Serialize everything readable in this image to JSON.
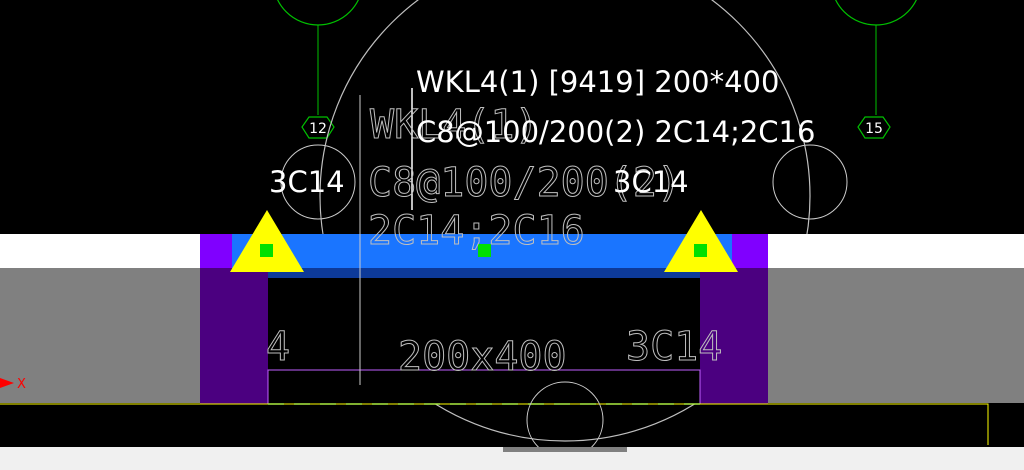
{
  "beam_annotation": {
    "line1": "WKL4(1) [9419] 200*400",
    "line2": "C8@100/200(2) 2C14;2C16"
  },
  "cad_text": {
    "beam_name": "WKL4(1)",
    "stirrups": "C8@100/200(2)",
    "top_bars": "2C14;2C16",
    "section": "200x400",
    "bottom_left": "4",
    "bottom_right": "3C14"
  },
  "support_labels": {
    "left": "3C14",
    "right": "3C14"
  },
  "axis_labels": {
    "left": "12",
    "right": "15"
  },
  "ucs": {
    "x": "X"
  },
  "colors": {
    "background": "#000000",
    "beam": "#1a75ff",
    "column": "#8000ff",
    "slab": "#808080",
    "support": "#ffff00",
    "grip": "#00ff00",
    "axis": "#00c000",
    "dim_line": "#00c0c0",
    "ucs": "#ff0000"
  }
}
